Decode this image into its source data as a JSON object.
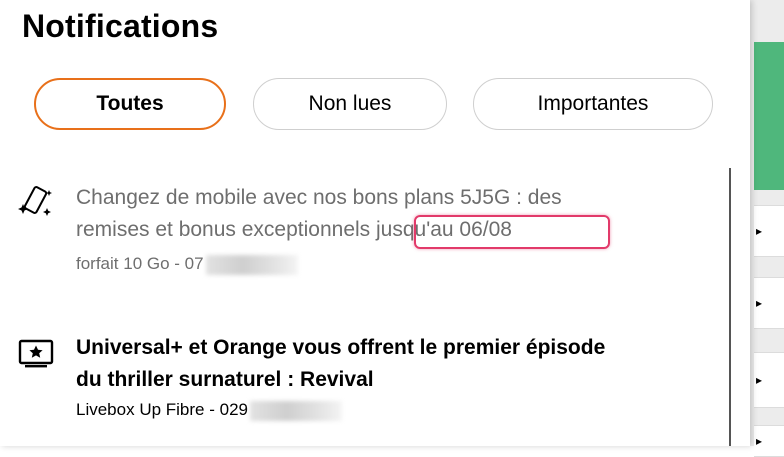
{
  "panel": {
    "title": "Notifications"
  },
  "filters": [
    {
      "label": "Toutes",
      "active": true
    },
    {
      "label": "Non lues",
      "active": false
    },
    {
      "label": "Importantes",
      "active": false
    }
  ],
  "notifications": [
    {
      "icon": "mobile-sparkle-icon",
      "message": "Changez de mobile avec nos bons plans 5J5G : des remises et bonus exceptionnels jusqu'au 06/08",
      "account": "forfait 10 Go - 07",
      "read": true
    },
    {
      "icon": "tv-star-icon",
      "message": "Universal+ et Orange vous offrent le premier épisode du thriller surnaturel : Revival",
      "account": "Livebox Up Fibre - 029",
      "read": false
    }
  ],
  "colors": {
    "accent": "#e8701a",
    "highlight": "#e23a6a",
    "green_banner": "#4fb77c",
    "read_text": "#6e6e6e"
  }
}
